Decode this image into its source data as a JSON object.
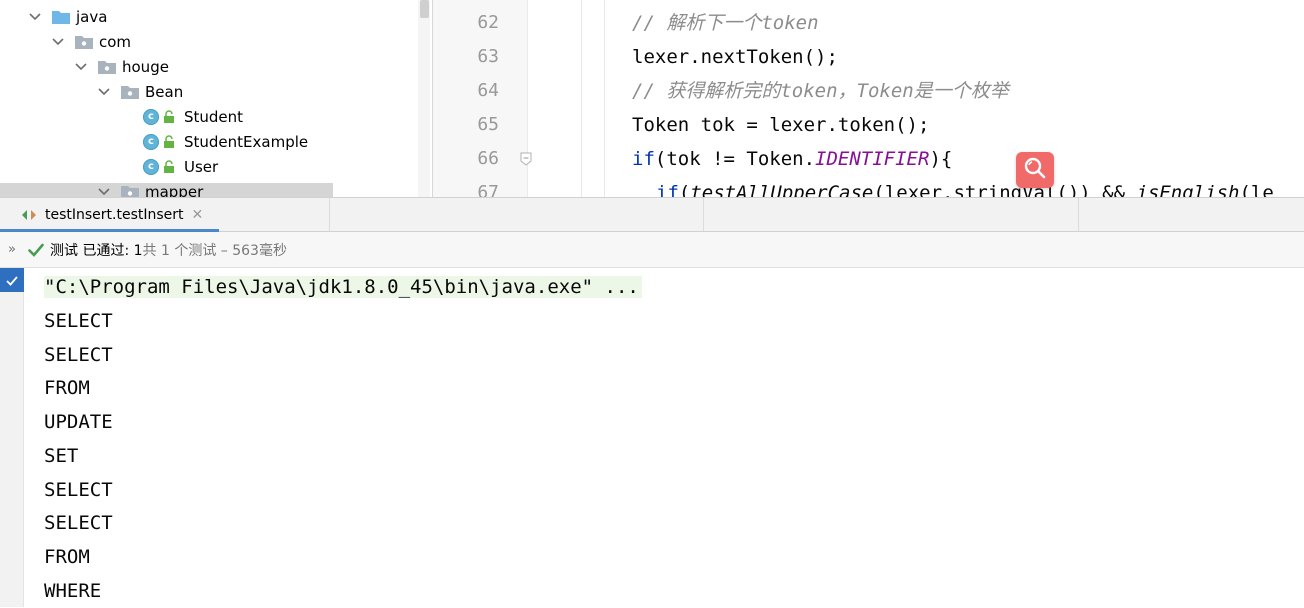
{
  "project_tree": [
    {
      "label": "java",
      "kind": "folder",
      "expanded": true
    },
    {
      "label": "com",
      "kind": "package",
      "expanded": true
    },
    {
      "label": "houge",
      "kind": "package",
      "expanded": true
    },
    {
      "label": "Bean",
      "kind": "package",
      "expanded": true
    },
    {
      "label": "Student",
      "kind": "class"
    },
    {
      "label": "StudentExample",
      "kind": "class"
    },
    {
      "label": "User",
      "kind": "class"
    },
    {
      "label": "mapper",
      "kind": "package",
      "expanded": true
    }
  ],
  "editor": {
    "line_numbers": [
      "62",
      "63",
      "64",
      "65",
      "66",
      "67"
    ],
    "lines": [
      {
        "comment": "// 解析下一个token"
      },
      {
        "code": "lexer.nextToken();"
      },
      {
        "comment": "// 获得解析完的token，Token是一个枚举"
      },
      {
        "code": "Token tok = lexer.token();"
      },
      {
        "kw": "if",
        "pre": "(tok != Token.",
        "const": "IDENTIFIER",
        "post": "){"
      },
      {
        "kw": "if",
        "pre": "(",
        "fn1": "testAllUpperCase",
        "mid": "(lexer.stringVal()) && ",
        "fn2": "isEnglish",
        "post": "(le"
      }
    ]
  },
  "run_panel": {
    "tab_label": "testInsert.testInsert",
    "status_passed": "测试 已通过: 1",
    "status_detail": "共 1 个测试 – 563毫秒",
    "command_line": "\"C:\\Program Files\\Java\\jdk1.8.0_45\\bin\\java.exe\" ...",
    "output_lines": [
      "SELECT",
      "SELECT",
      "FROM",
      "UPDATE",
      "SET",
      "SELECT",
      "SELECT",
      "FROM",
      "WHERE"
    ]
  },
  "colors": {
    "accent": "#4a88c7",
    "pass_green": "#499c54",
    "search_button": "#f16a6a",
    "keyword": "#0033b3",
    "constant": "#871094"
  }
}
